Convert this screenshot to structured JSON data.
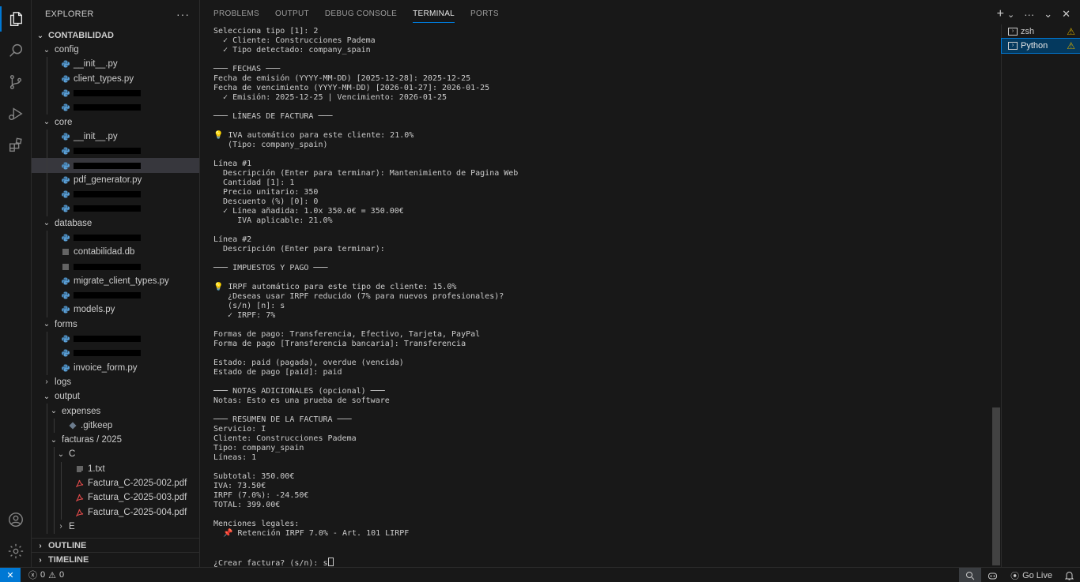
{
  "sidebar": {
    "title": "EXPLORER",
    "more": "···",
    "project": "CONTABILIDAD",
    "tree": [
      {
        "label": "config",
        "type": "folder",
        "depth": 1,
        "open": true
      },
      {
        "label": "__init__.py",
        "type": "py",
        "depth": 2
      },
      {
        "label": "client_types.py",
        "type": "py",
        "depth": 2
      },
      {
        "label": "",
        "type": "py",
        "depth": 2,
        "redacted": true
      },
      {
        "label": "",
        "type": "py",
        "depth": 2,
        "redacted": true
      },
      {
        "label": "core",
        "type": "folder",
        "depth": 1,
        "open": true
      },
      {
        "label": "__init__.py",
        "type": "py",
        "depth": 2
      },
      {
        "label": "",
        "type": "py",
        "depth": 2,
        "redacted": true
      },
      {
        "label": "",
        "type": "py",
        "depth": 2,
        "redacted": true,
        "selected": true
      },
      {
        "label": "pdf_generator.py",
        "type": "py",
        "depth": 2
      },
      {
        "label": "",
        "type": "py",
        "depth": 2,
        "redacted": true
      },
      {
        "label": "",
        "type": "py",
        "depth": 2,
        "redacted": true
      },
      {
        "label": "database",
        "type": "folder",
        "depth": 1,
        "open": true
      },
      {
        "label": "",
        "type": "py",
        "depth": 2,
        "redacted": true
      },
      {
        "label": "contabilidad.db",
        "type": "db",
        "depth": 2
      },
      {
        "label": "",
        "type": "db",
        "depth": 2,
        "redacted": true
      },
      {
        "label": "migrate_client_types.py",
        "type": "py",
        "depth": 2
      },
      {
        "label": "",
        "type": "py",
        "depth": 2,
        "redacted": true
      },
      {
        "label": "models.py",
        "type": "py",
        "depth": 2
      },
      {
        "label": "forms",
        "type": "folder",
        "depth": 1,
        "open": true
      },
      {
        "label": "",
        "type": "py",
        "depth": 2,
        "redacted": true
      },
      {
        "label": "",
        "type": "py",
        "depth": 2,
        "redacted": true
      },
      {
        "label": "invoice_form.py",
        "type": "py",
        "depth": 2
      },
      {
        "label": "logs",
        "type": "folder",
        "depth": 1,
        "open": false
      },
      {
        "label": "output",
        "type": "folder",
        "depth": 1,
        "open": true
      },
      {
        "label": "expenses",
        "type": "folder",
        "depth": 2,
        "open": true
      },
      {
        "label": ".gitkeep",
        "type": "git",
        "depth": 3
      },
      {
        "label": "facturas / 2025",
        "type": "folder",
        "depth": 2,
        "open": true
      },
      {
        "label": "C",
        "type": "folder",
        "depth": 3,
        "open": true
      },
      {
        "label": "1.txt",
        "type": "txt",
        "depth": 4
      },
      {
        "label": "Factura_C-2025-002.pdf",
        "type": "pdf",
        "depth": 4
      },
      {
        "label": "Factura_C-2025-003.pdf",
        "type": "pdf",
        "depth": 4
      },
      {
        "label": "Factura_C-2025-004.pdf",
        "type": "pdf",
        "depth": 4
      },
      {
        "label": "E",
        "type": "folder",
        "depth": 3,
        "open": false
      }
    ],
    "outline": "OUTLINE",
    "timeline": "TIMELINE"
  },
  "panel": {
    "tabs": [
      "PROBLEMS",
      "OUTPUT",
      "DEBUG CONSOLE",
      "TERMINAL",
      "PORTS"
    ],
    "active_tab": "TERMINAL",
    "actions": {
      "add": "+",
      "dropdown": "⌄",
      "more": "···",
      "maximize": "⌄",
      "close": "✕"
    }
  },
  "terminal": {
    "lines": [
      "Selecciona tipo [1]: 2",
      "  ✓ Cliente: Construcciones Padema",
      "  ✓ Tipo detectado: company_spain",
      "",
      "─── FECHAS ───",
      "Fecha de emisión (YYYY-MM-DD) [2025-12-28]: 2025-12-25",
      "Fecha de vencimiento (YYYY-MM-DD) [2026-01-27]: 2026-01-25",
      "  ✓ Emisión: 2025-12-25 | Vencimiento: 2026-01-25",
      "",
      "─── LÍNEAS DE FACTURA ───",
      "",
      "💡 IVA automático para este cliente: 21.0%",
      "   (Tipo: company_spain)",
      "",
      "Línea #1",
      "  Descripción (Enter para terminar): Mantenimiento de Pagina Web",
      "  Cantidad [1]: 1",
      "  Precio unitario: 350",
      "  Descuento (%) [0]: 0",
      "  ✓ Línea añadida: 1.0x 350.0€ = 350.00€",
      "     IVA aplicable: 21.0%",
      "",
      "Línea #2",
      "  Descripción (Enter para terminar):",
      "",
      "─── IMPUESTOS Y PAGO ───",
      "",
      "💡 IRPF automático para este tipo de cliente: 15.0%",
      "   ¿Deseas usar IRPF reducido (7% para nuevos profesionales)?",
      "   (s/n) [n]: s",
      "   ✓ IRPF: 7%",
      "",
      "Formas de pago: Transferencia, Efectivo, Tarjeta, PayPal",
      "Forma de pago [Transferencia bancaria]: Transferencia",
      "",
      "Estado: paid (pagada), overdue (vencida)",
      "Estado de pago [paid]: paid",
      "",
      "─── NOTAS ADICIONALES (opcional) ───",
      "Notas: Esto es una prueba de software",
      "",
      "─── RESUMEN DE LA FACTURA ───",
      "Servicio: I",
      "Cliente: Construcciones Padema",
      "Tipo: company_spain",
      "Líneas: 1",
      "",
      "Subtotal: 350.00€",
      "IVA: 73.50€",
      "IRPF (7.0%): -24.50€",
      "TOTAL: 399.00€",
      "",
      "Menciones legales:",
      "  📌 Retención IRPF 7.0% - Art. 101 LIRPF",
      "",
      "",
      "¿Crear factura? (s/n): s"
    ],
    "sessions": [
      {
        "label": "zsh",
        "warn": "⚠",
        "active": false
      },
      {
        "label": "Python",
        "warn": "⚠",
        "active": true
      }
    ]
  },
  "statusbar": {
    "remote": "✕",
    "errors": "0",
    "warnings": "0",
    "golive": "Go Live"
  }
}
